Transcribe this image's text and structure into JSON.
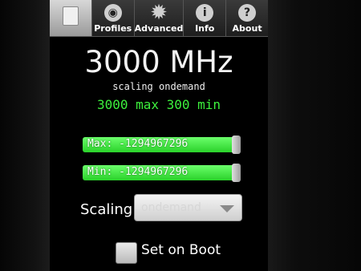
{
  "tabs": [
    {
      "label": "",
      "icon": "document-icon"
    },
    {
      "label": "Profiles",
      "icon": "profiles-icon"
    },
    {
      "label": "Advanced",
      "icon": "gear-icon"
    },
    {
      "label": "Info",
      "icon": "info-icon"
    },
    {
      "label": "About",
      "icon": "help-icon"
    }
  ],
  "status": {
    "current_freq": "3000 MHz",
    "governor_line": "scaling ondemand",
    "range_line": "3000 max 300 min"
  },
  "sliders": {
    "max_label": "Max: -1294967296",
    "min_label": "Min: -1294967296"
  },
  "scaling": {
    "label": "Scaling",
    "selected": "ondemand"
  },
  "boot": {
    "label": "Set on Boot",
    "checked": false
  },
  "colors": {
    "accent_green": "#3df03d",
    "slider_green": "#4be84b"
  }
}
